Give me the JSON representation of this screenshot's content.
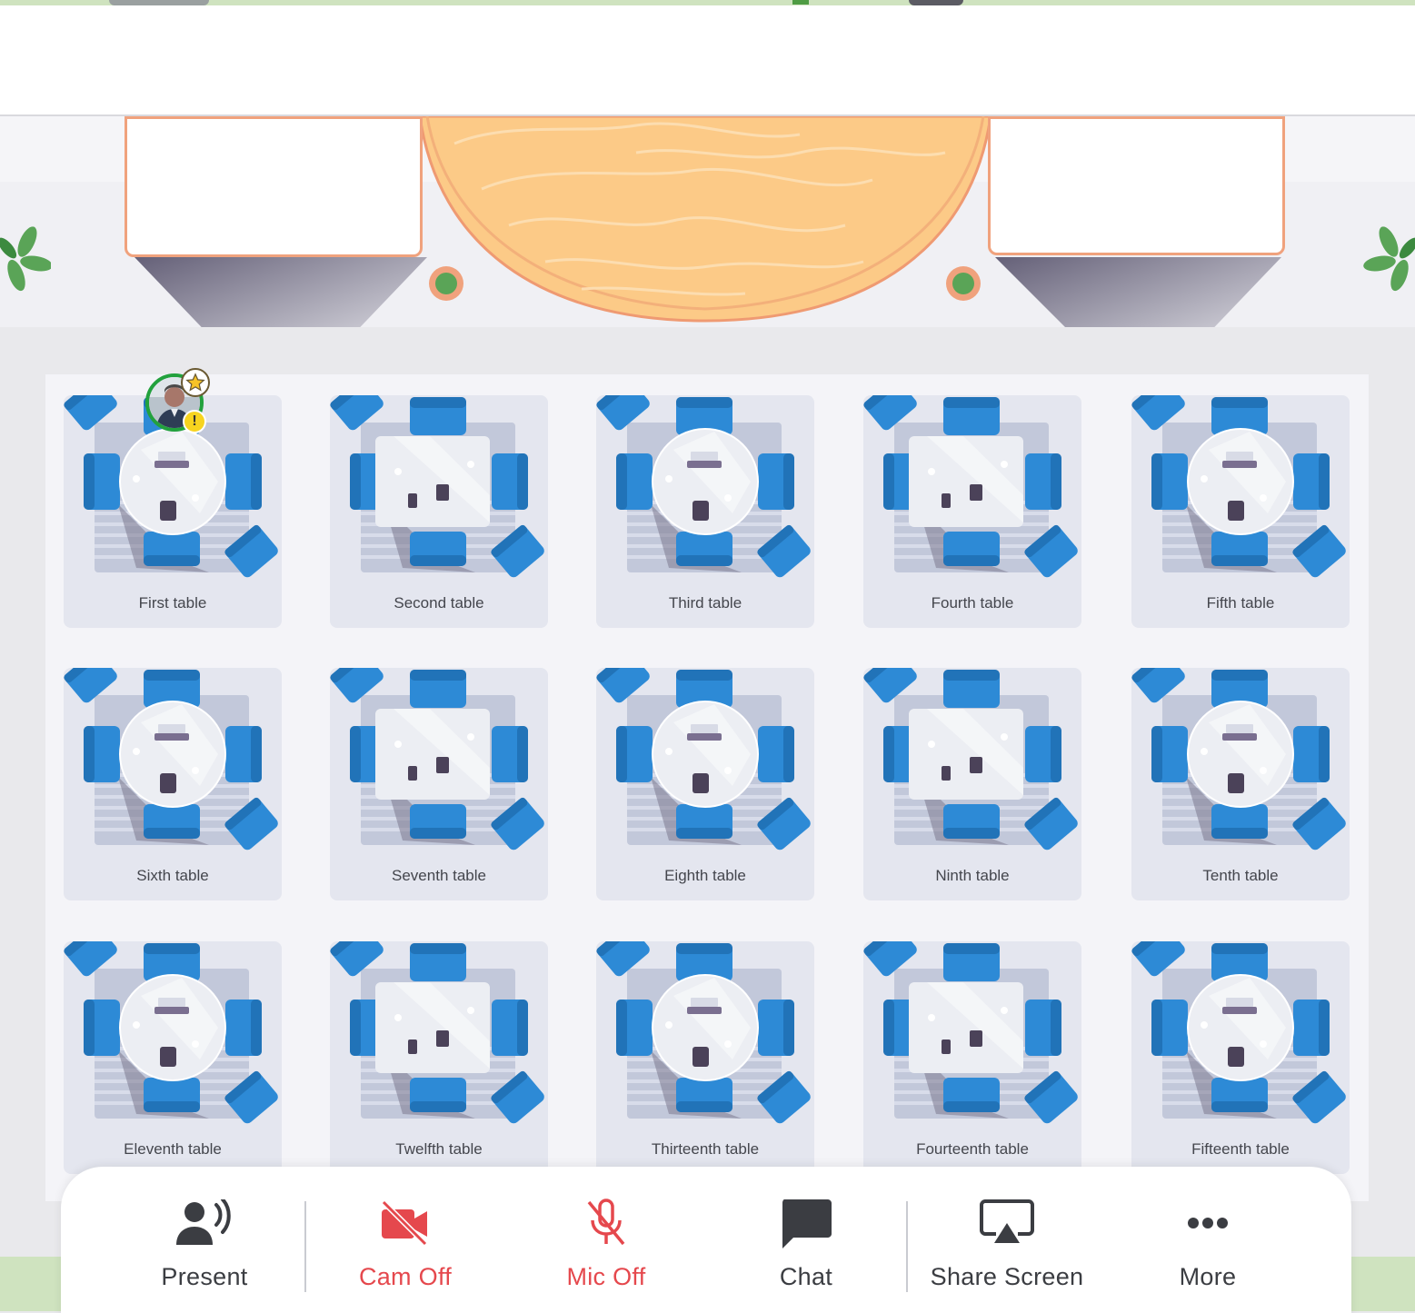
{
  "tables": [
    {
      "label": "First table",
      "shape": "round"
    },
    {
      "label": "Second table",
      "shape": "square"
    },
    {
      "label": "Third table",
      "shape": "round"
    },
    {
      "label": "Fourth table",
      "shape": "square"
    },
    {
      "label": "Fifth table",
      "shape": "round"
    },
    {
      "label": "Sixth table",
      "shape": "round"
    },
    {
      "label": "Seventh table",
      "shape": "square"
    },
    {
      "label": "Eighth table",
      "shape": "round"
    },
    {
      "label": "Ninth table",
      "shape": "square"
    },
    {
      "label": "Tenth table",
      "shape": "round"
    },
    {
      "label": "Eleventh table",
      "shape": "round"
    },
    {
      "label": "Twelfth table",
      "shape": "square"
    },
    {
      "label": "Thirteenth table",
      "shape": "round"
    },
    {
      "label": "Fourteenth table",
      "shape": "square"
    },
    {
      "label": "Fifteenth table",
      "shape": "round"
    }
  ],
  "toolbar": {
    "present": {
      "label": "Present",
      "icon": "present-icon"
    },
    "cam": {
      "label": "Cam Off",
      "icon": "camera-off-icon"
    },
    "mic": {
      "label": "Mic Off",
      "icon": "mic-off-icon"
    },
    "chat": {
      "label": "Chat",
      "icon": "chat-icon"
    },
    "share": {
      "label": "Share Screen",
      "icon": "share-screen-icon"
    },
    "more": {
      "label": "More",
      "icon": "more-icon"
    }
  },
  "user": {
    "icon": "avatar",
    "host_badge": "star-icon",
    "status_badge": "!"
  },
  "colors": {
    "chair": "#2d8ad6",
    "table_top": "#eceef3",
    "tile_bg": "#e4e6ef",
    "stage_wood": "#fcca87",
    "accent_off": "#e5484d",
    "avatar_ring": "#22a13d"
  }
}
